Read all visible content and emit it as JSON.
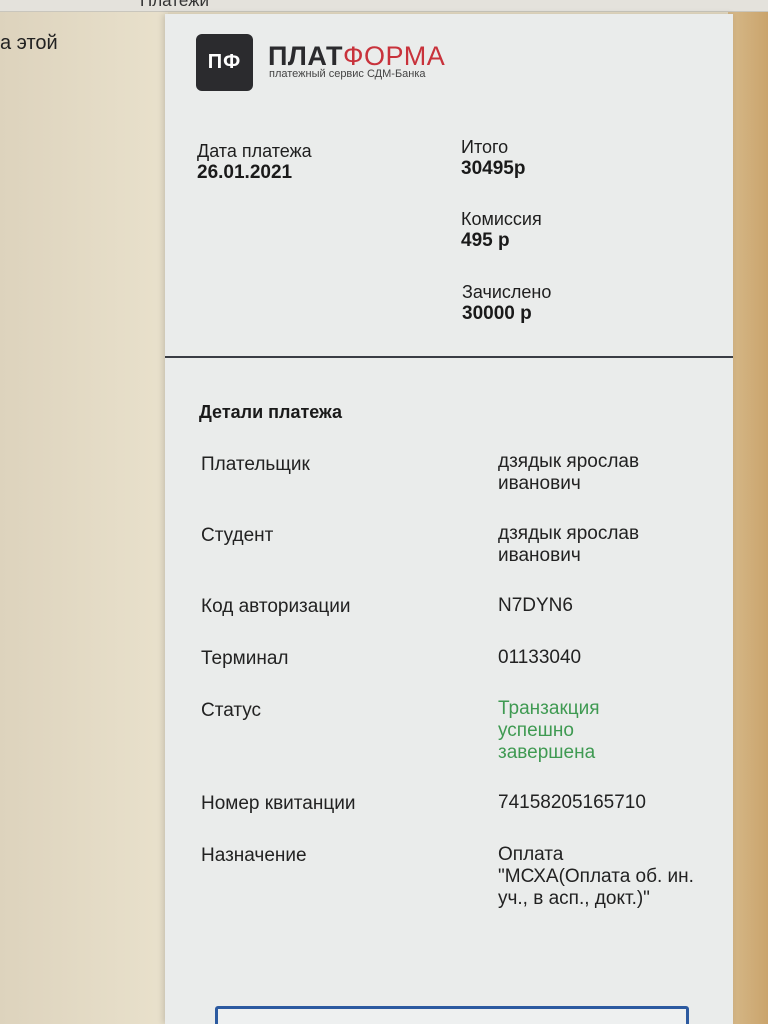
{
  "background": {
    "tab_label": "Платежи",
    "side_fragment": "а этой"
  },
  "logo": {
    "icon_text": "ПФ",
    "title_dark": "ПЛАТ",
    "title_red": "ФОРМА",
    "subtitle": "платежный сервис СДМ-Банка"
  },
  "summary": {
    "date_label": "Дата платежа",
    "date_value": "26.01.2021",
    "total_label": "Итого",
    "total_value": "30495р",
    "commission_label": "Комиссия",
    "commission_value": "495 р",
    "credited_label": "Зачислено",
    "credited_value": "30000 р"
  },
  "details": {
    "heading": "Детали платежа",
    "rows": [
      {
        "label": "Плательщик",
        "value": "дзядык ярослав иванович"
      },
      {
        "label": "Студент",
        "value": "дзядык ярослав иванович"
      },
      {
        "label": "Код авторизации",
        "value": "N7DYN6"
      },
      {
        "label": "Терминал",
        "value": "01133040"
      },
      {
        "label": "Статус",
        "value": "Транзакция успешно завершена"
      },
      {
        "label": "Номер квитанции",
        "value": "74158205165710"
      },
      {
        "label": "Назначение",
        "value": "Оплата \"МСХА(Оплата об. ин. уч., в асп., докт.)\""
      }
    ]
  },
  "colors": {
    "brand_dark": "#2b2b2e",
    "brand_red": "#c8323b",
    "status_success": "#3f9a52",
    "button_border": "#2c5aa0"
  }
}
